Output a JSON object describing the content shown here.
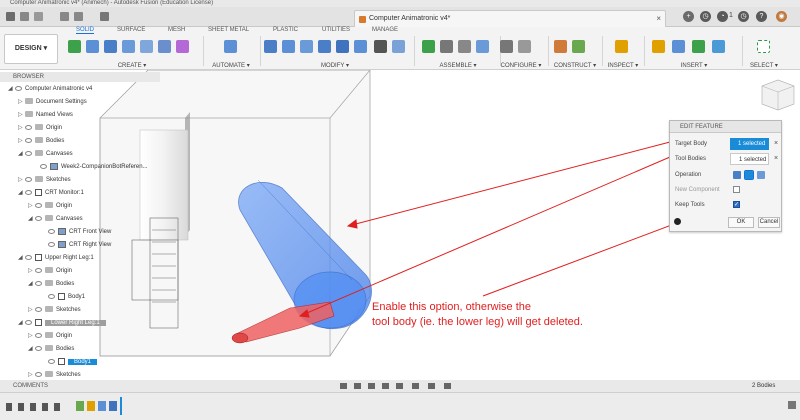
{
  "window": {
    "title": "Computer Animatronic v4* (Animech) - Autodesk Fusion (Education License)"
  },
  "document_tab": {
    "label": "Computer Animatronic v4*"
  },
  "top_right": {
    "notification_count": "1"
  },
  "ribbon": {
    "workspace_button": "DESIGN ▾",
    "tabs": [
      "SOLID",
      "SURFACE",
      "MESH",
      "SHEET METAL",
      "PLASTIC",
      "UTILITIES",
      "MANAGE"
    ],
    "active_tab": "SOLID",
    "groups": [
      "CREATE ▾",
      "AUTOMATE ▾",
      "MODIFY ▾",
      "ASSEMBLE ▾",
      "CONFIGURE ▾",
      "CONSTRUCT ▾",
      "INSPECT ▾",
      "INSERT ▾",
      "SELECT ▾"
    ]
  },
  "browser": {
    "title": "BROWSER",
    "items": [
      {
        "label": "Computer Animatronic v4"
      },
      {
        "label": "Document Settings"
      },
      {
        "label": "Named Views"
      },
      {
        "label": "Origin"
      },
      {
        "label": "Bodies"
      },
      {
        "label": "Canvases"
      },
      {
        "label": "Week2-CompanionBotReferen..."
      },
      {
        "label": "Sketches"
      },
      {
        "label": "CRT Monitor:1"
      },
      {
        "label": "Origin"
      },
      {
        "label": "Canvases"
      },
      {
        "label": "CRT Front View"
      },
      {
        "label": "CRT Right View"
      },
      {
        "label": "Upper Right Leg:1"
      },
      {
        "label": "Origin"
      },
      {
        "label": "Bodies"
      },
      {
        "label": "Body1"
      },
      {
        "label": "Sketches"
      },
      {
        "label": "Lower Right Leg:1"
      },
      {
        "label": "Origin"
      },
      {
        "label": "Bodies"
      },
      {
        "label": "Body1"
      },
      {
        "label": "Sketches"
      }
    ]
  },
  "dialog": {
    "title": "EDIT FEATURE",
    "target_body_label": "Target Body",
    "target_body_value": "1 selected",
    "tool_bodies_label": "Tool Bodies",
    "tool_bodies_value": "1 selected",
    "operation_label": "Operation",
    "new_component_label": "New Component",
    "keep_tools_label": "Keep Tools",
    "keep_tools_checked": true,
    "ok_label": "OK",
    "cancel_label": "Cancel"
  },
  "annotation": {
    "line1": "Enable this option, otherwise the",
    "line2": "tool body (ie. the lower leg) will get deleted.",
    "color": "#e01f1f"
  },
  "bottom": {
    "comments_label": "COMMENTS",
    "bodies_count": "2 Bodies"
  },
  "colors": {
    "accent": "#1a8bd8",
    "annotation_red": "#e01f1f",
    "body_blue": "#4d8cf5"
  }
}
